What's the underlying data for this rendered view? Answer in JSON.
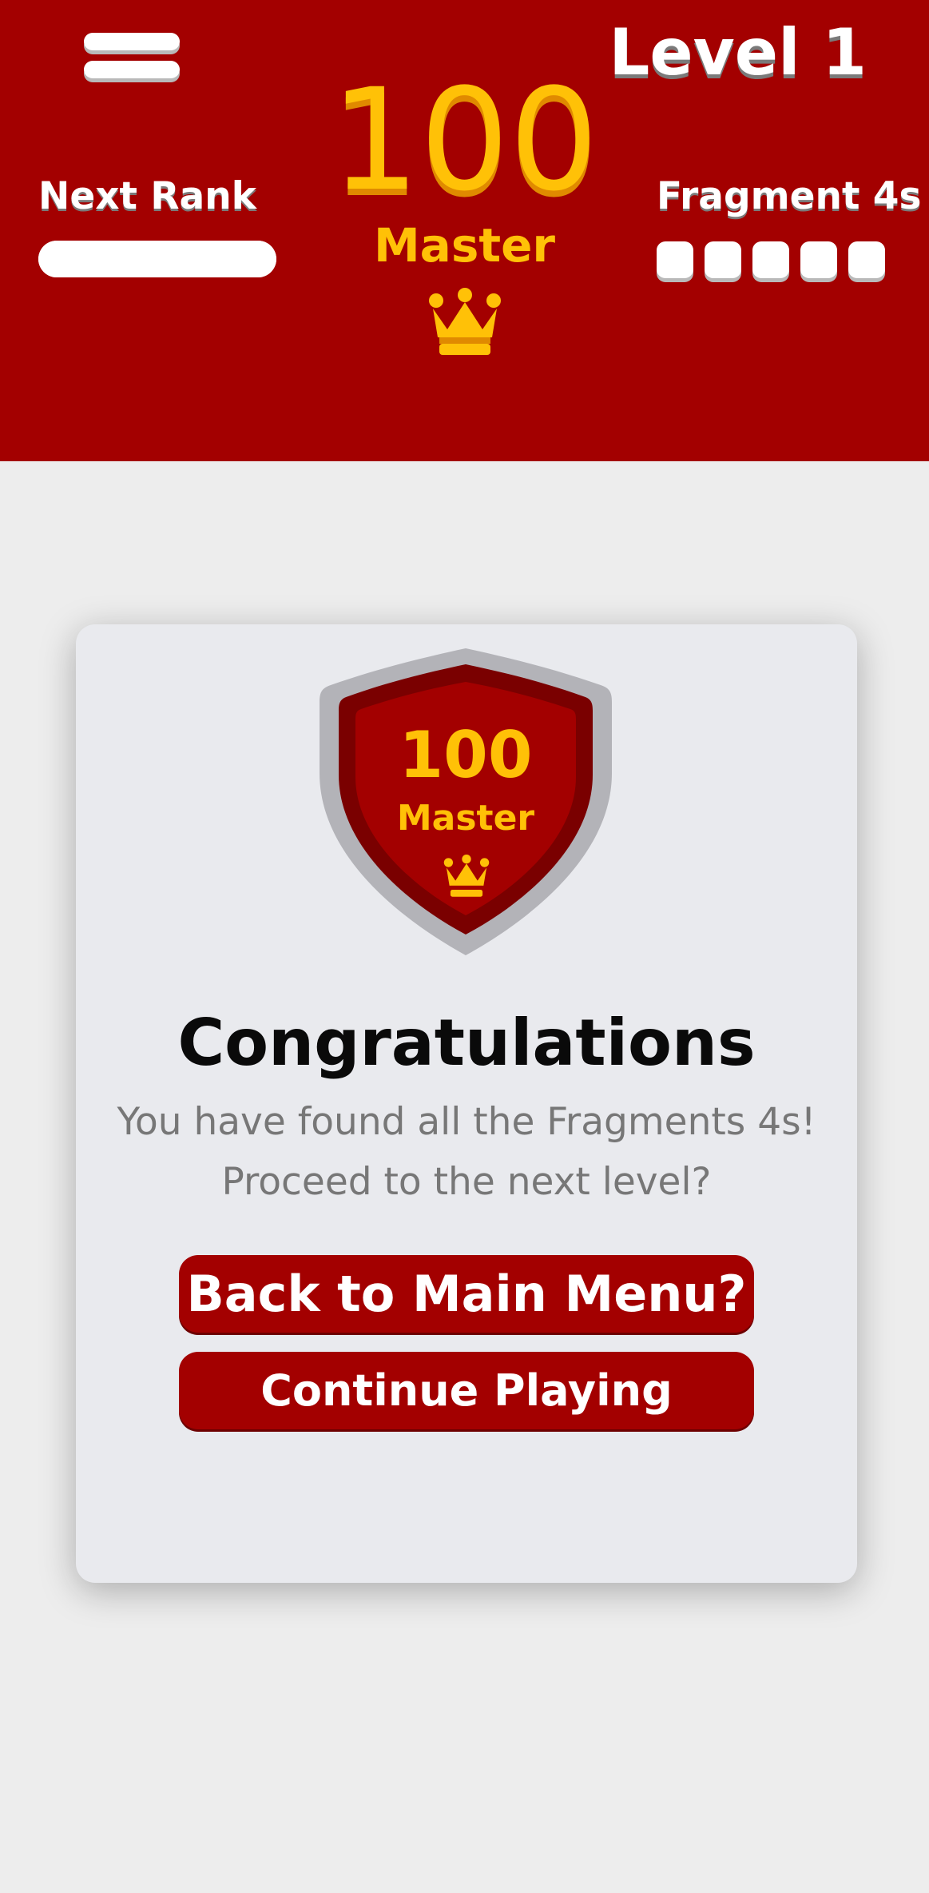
{
  "header": {
    "level_label": "Level 1",
    "score": "100",
    "rank_name": "Master",
    "next_rank_label": "Next Rank",
    "next_rank_progress": 1.0,
    "fragments_label": "Fragment 4s",
    "fragment_slots_total": 5,
    "menu_icon": "hamburger-menu-icon",
    "rank_icon": "crown-icon"
  },
  "dialog": {
    "badge": {
      "score": "100",
      "rank_name": "Master",
      "icon": "crown-icon"
    },
    "title": "Congratulations",
    "message_line1": "You have found all the Fragments 4s!",
    "message_line2": "Proceed to the next level?",
    "main_menu_button": "Back to Main Menu?",
    "continue_button": "Continue Playing"
  },
  "colors": {
    "primary_red": "#a30000",
    "dark_red": "#7a0000",
    "gold": "#ffc107",
    "background": "#ededed",
    "card": "#e9eaee"
  }
}
